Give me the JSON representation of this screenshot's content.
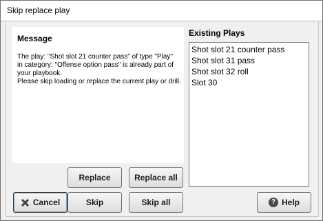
{
  "window": {
    "title": "Skip replace play"
  },
  "message": {
    "heading": "Message",
    "lines": [
      "The play: \"Shot slot 21 counter pass\" of type \"Play\"",
      "in category: \"Offense option pass\" is already part of",
      "your playbook.",
      "Please skip loading or replace the current play or drill."
    ]
  },
  "existing_plays": {
    "heading": "Existing Plays",
    "items": [
      "Shot slot 21 counter pass",
      "Shot slot 31 pass",
      "Shot slot 32 roll",
      "Slot 30"
    ]
  },
  "buttons": {
    "replace": "Replace",
    "replace_all": "Replace all",
    "cancel": "Cancel",
    "skip": "Skip",
    "skip_all": "Skip all",
    "help": "Help"
  },
  "icons": {
    "cancel": "close-icon",
    "help": "help-icon"
  }
}
